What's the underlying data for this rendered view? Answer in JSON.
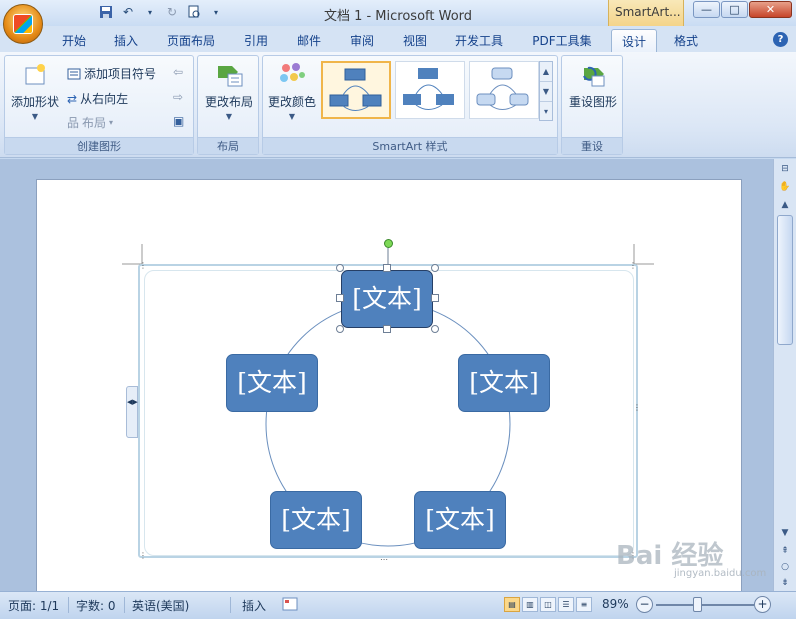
{
  "window": {
    "title": "文档 1 - Microsoft Word",
    "context_tab_title": "SmartArt...",
    "minimize": "—",
    "maximize": "□",
    "close": "✕"
  },
  "tabs": [
    {
      "label": "开始"
    },
    {
      "label": "插入"
    },
    {
      "label": "页面布局"
    },
    {
      "label": "引用"
    },
    {
      "label": "邮件"
    },
    {
      "label": "审阅"
    },
    {
      "label": "视图"
    },
    {
      "label": "开发工具"
    },
    {
      "label": "PDF工具集"
    },
    {
      "label": "设计",
      "active": true
    },
    {
      "label": "格式"
    }
  ],
  "help": "?",
  "ribbon": {
    "create_graphic": {
      "label": "创建图形",
      "add_shape": "添加形状",
      "add_bullet": "添加项目符号",
      "right_to_left": "从右向左",
      "layout": "布局"
    },
    "layouts": {
      "label": "布局",
      "change_layout": "更改布局"
    },
    "styles": {
      "label": "SmartArt 样式",
      "change_colors": "更改颜色"
    },
    "reset": {
      "label": "重设",
      "reset_graphic": "重设图形"
    }
  },
  "smartart": {
    "nodes": [
      "[文本]",
      "[文本]",
      "[文本]",
      "[文本]",
      "[文本]"
    ],
    "panel_toggle": "◀▶"
  },
  "statusbar": {
    "page": "页面: 1/1",
    "words": "字数: 0",
    "language": "英语(美国)",
    "mode": "插入",
    "zoom": "89%",
    "zoom_out": "−",
    "zoom_in": "+"
  },
  "watermark": {
    "text": "Bai 经验",
    "sub": "jingyan.baidu.com"
  },
  "colors": {
    "node_fill": "#4f81bd",
    "ribbon_bg": "#dce7f6",
    "accent": "#f0b54a"
  }
}
